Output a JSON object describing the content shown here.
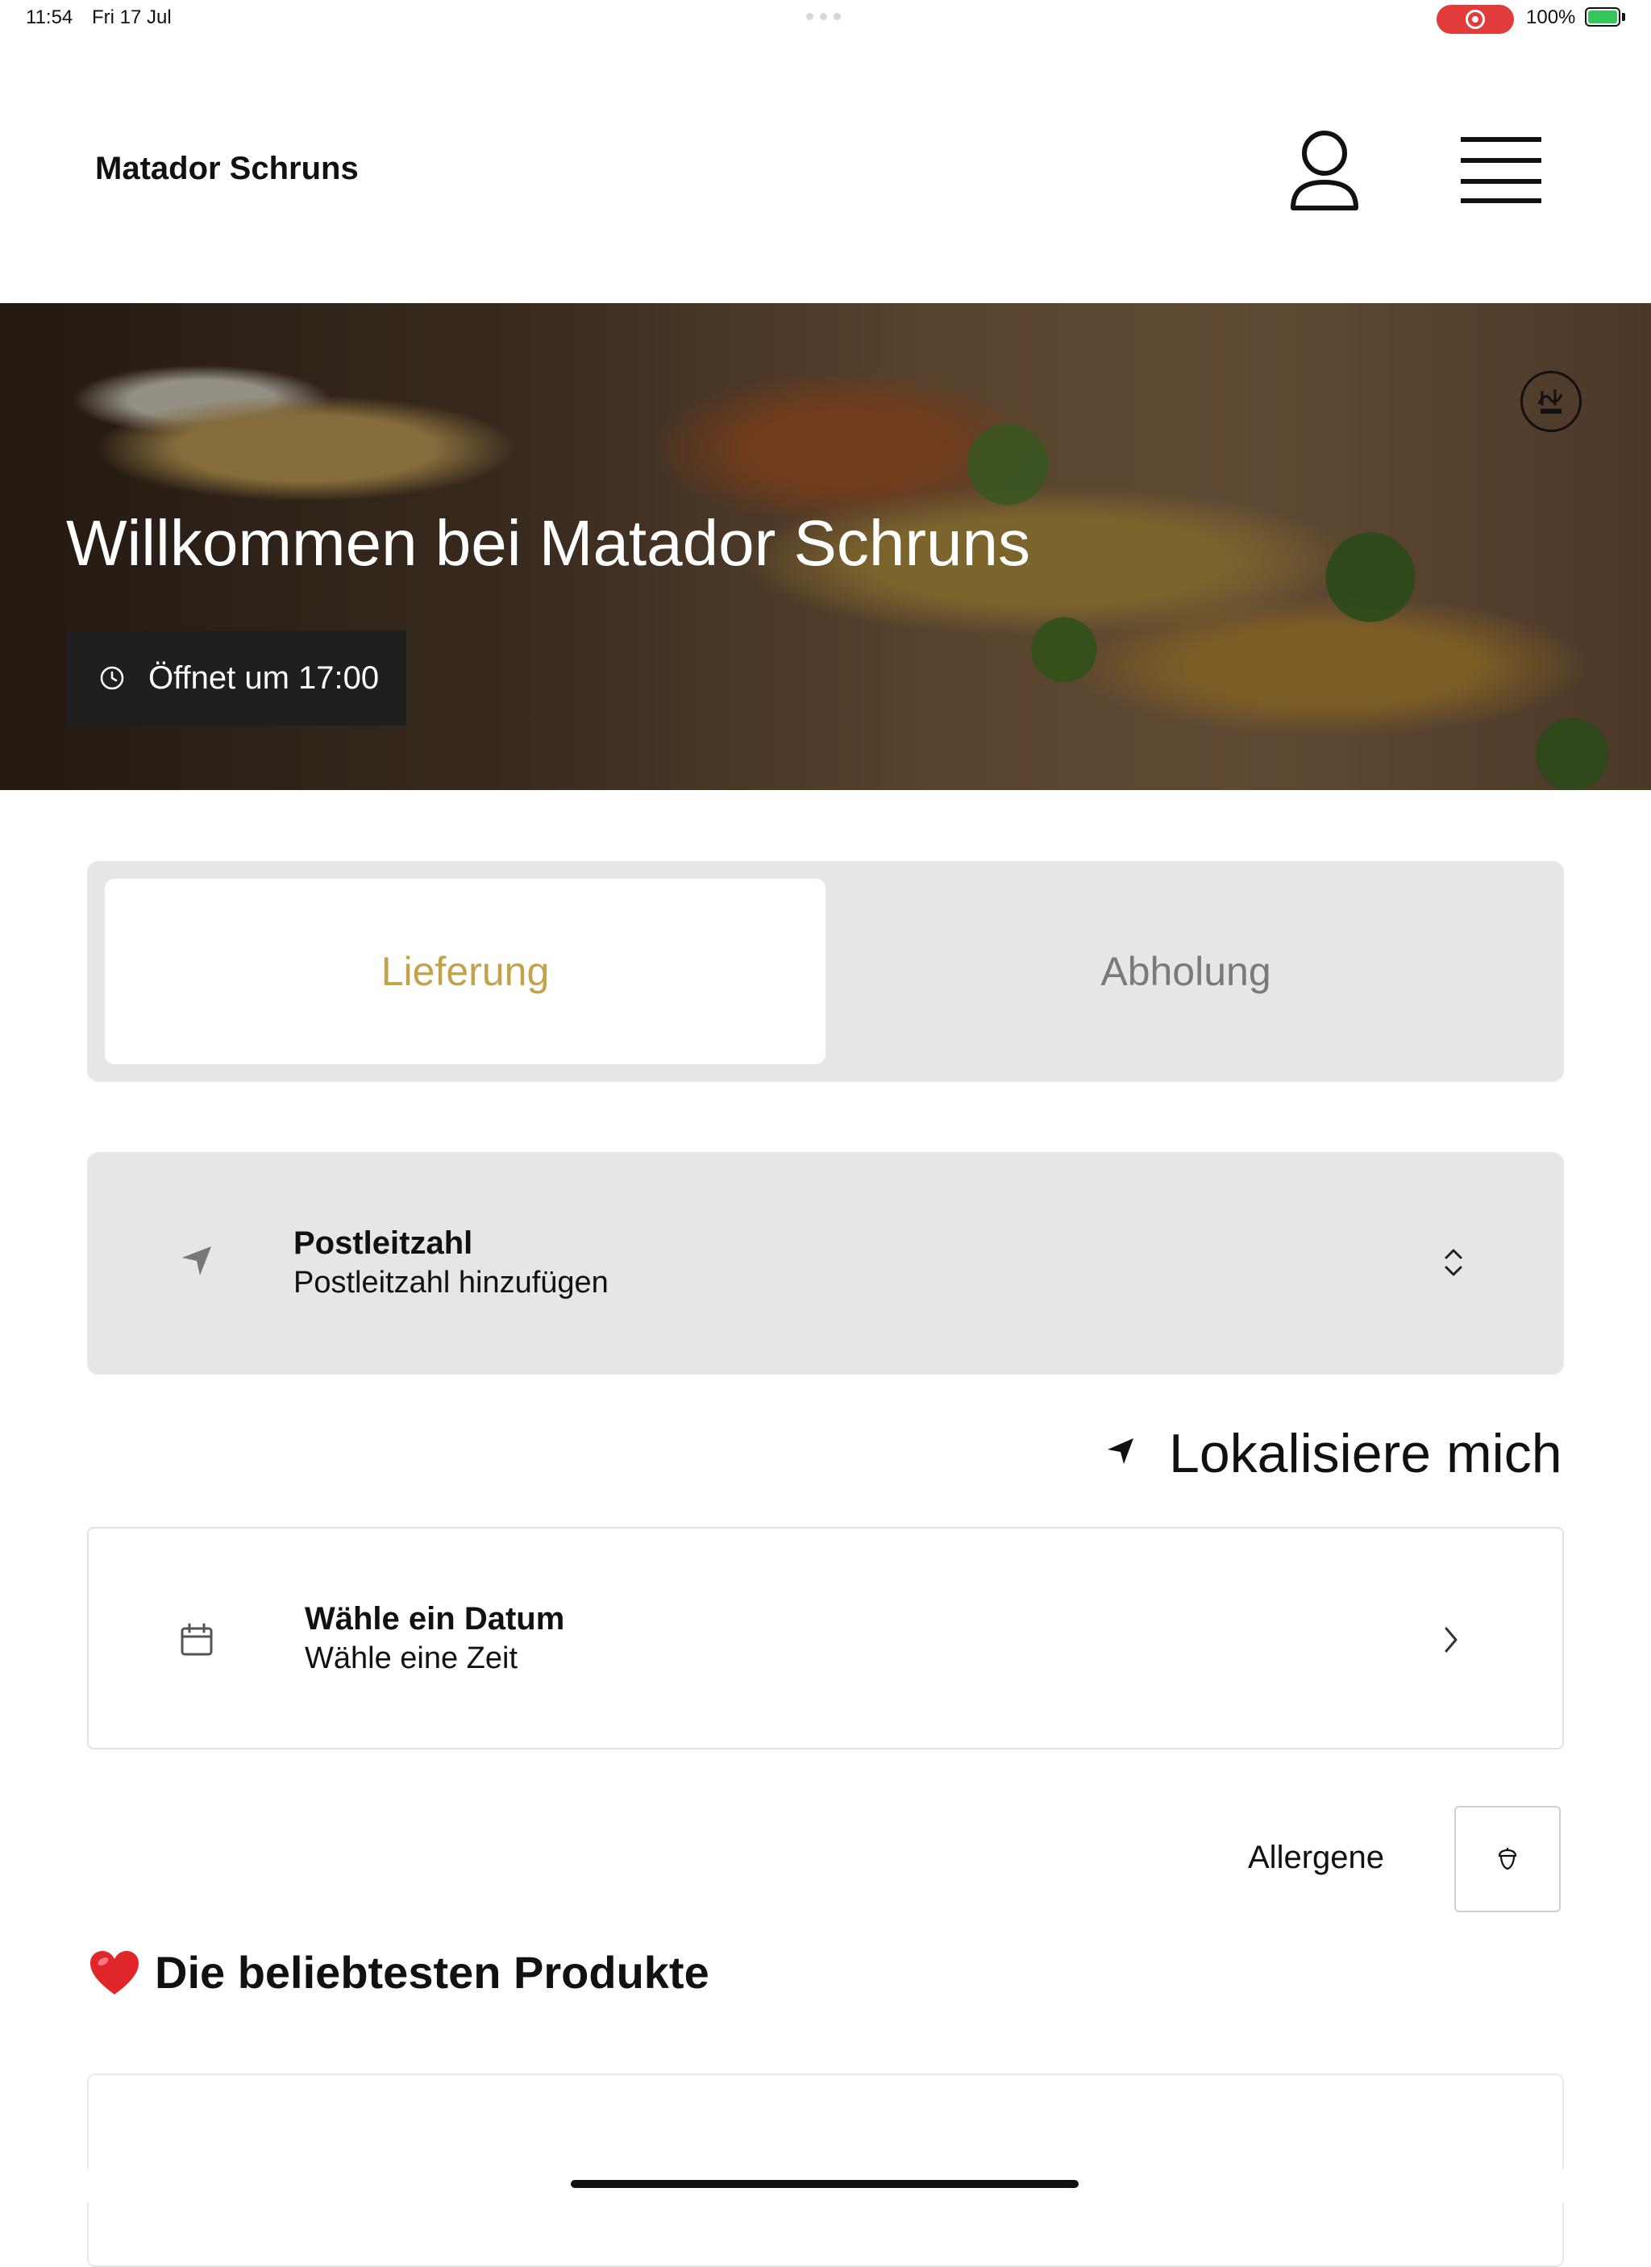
{
  "status_bar": {
    "time": "11:54",
    "date": "Fri 17 Jul",
    "battery": "100%",
    "record_color": "#e23b3b",
    "battery_color": "#33c759"
  },
  "header": {
    "brand": "Matador Schruns",
    "account_icon": "user-icon",
    "menu_icon": "hamburger-menu-icon"
  },
  "hero": {
    "title": "Willkommen bei Matador Schruns",
    "opening_hours": "Öffnet um 17:00",
    "clock_icon": "clock-icon",
    "badge_icon": "halal-badge-icon"
  },
  "order_mode": {
    "tabs": [
      {
        "label": "Lieferung",
        "active": true
      },
      {
        "label": "Abholung",
        "active": false
      }
    ],
    "accent_color": "#c3a24b"
  },
  "postal": {
    "label": "Postleitzahl",
    "value": "Postleitzahl hinzufügen",
    "icon": "navigation-arrow-icon"
  },
  "locate": {
    "label": "Lokalisiere mich",
    "icon": "location-arrow-icon"
  },
  "schedule": {
    "date_label": "Wähle ein Datum",
    "time_label": "Wähle eine Zeit",
    "icon": "calendar-icon"
  },
  "allergens": {
    "label": "Allergene",
    "icon": "acorn-icon"
  },
  "popular": {
    "title": "Die beliebtesten Produkte",
    "icon": "heart-icon"
  }
}
